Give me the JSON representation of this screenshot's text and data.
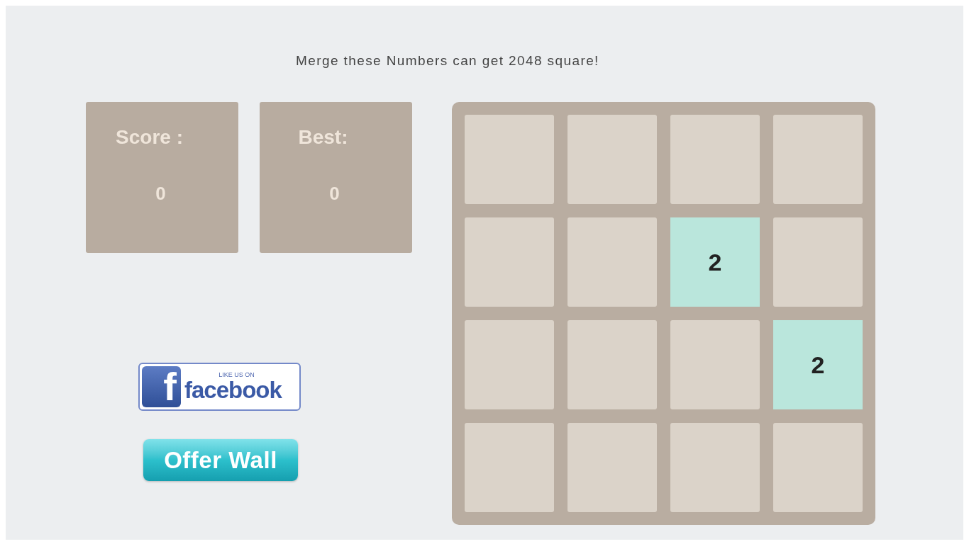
{
  "heading": "Merge these Numbers can get 2048 square!",
  "scores": [
    {
      "label": "Score :",
      "value": "0"
    },
    {
      "label": "Best:",
      "value": "0"
    }
  ],
  "buttons": [
    {
      "kind": "facebook",
      "logo": "f",
      "caption": "LIKE US ON",
      "label": "facebook"
    },
    {
      "kind": "offer",
      "label": "Offer Wall"
    }
  ],
  "board": {
    "rows": [
      [
        null,
        null,
        null,
        null
      ],
      [
        null,
        null,
        "2",
        null
      ],
      [
        null,
        null,
        null,
        "2"
      ],
      [
        null,
        null,
        null,
        null
      ]
    ]
  }
}
